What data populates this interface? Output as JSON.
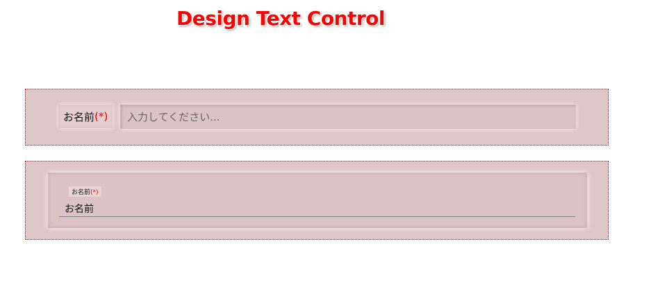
{
  "page": {
    "title": "Design Text Control"
  },
  "colors": {
    "title": "#ff0000",
    "panel_bg": "#dfc6c7",
    "panel_border": "#e60000",
    "required": "#e60000",
    "underline": "#7f8288"
  },
  "form1": {
    "label": "お名前",
    "required_mark": "(*)",
    "placeholder": "入力してください..."
  },
  "form2": {
    "label": "お名前",
    "required_mark": "(*)",
    "value": "お名前"
  }
}
